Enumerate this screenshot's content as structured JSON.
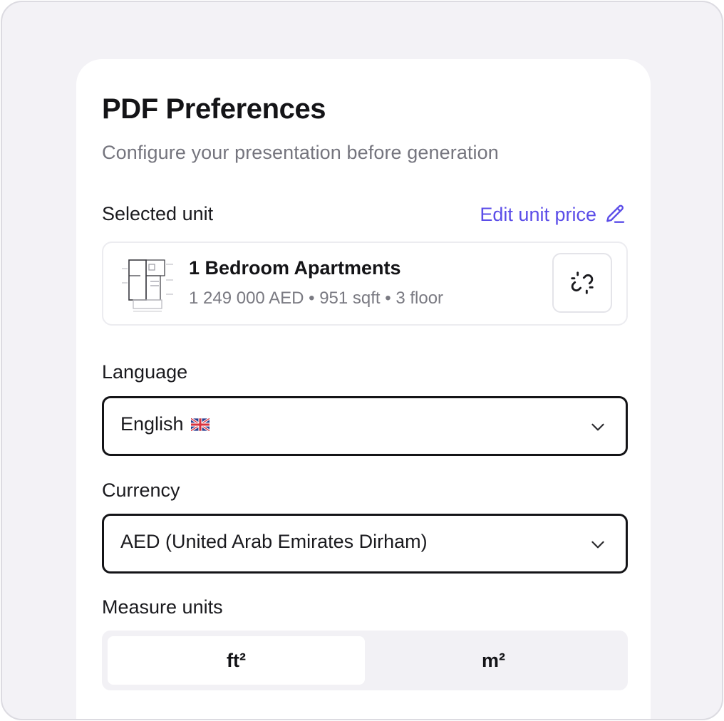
{
  "header": {
    "title": "PDF Preferences",
    "subtitle": "Configure your presentation before generation"
  },
  "selected_unit": {
    "label": "Selected unit",
    "edit_label": "Edit unit price",
    "name": "1 Bedroom Apartments",
    "meta": "1 249 000 AED • 951 sqft • 3 floor",
    "thumbnail_icon": "floorplan-thumbnail",
    "action_icon": "unlink-icon"
  },
  "language": {
    "label": "Language",
    "value": "English",
    "flag_icon": "uk-flag-icon"
  },
  "currency": {
    "label": "Currency",
    "value": "AED (United Arab Emirates Dirham)"
  },
  "measure_units": {
    "label": "Measure units",
    "options": [
      "ft²",
      "m²"
    ],
    "selected": "ft²"
  },
  "colors": {
    "accent": "#5b4de8",
    "border_active": "#141417",
    "background": "#f3f2f6"
  }
}
